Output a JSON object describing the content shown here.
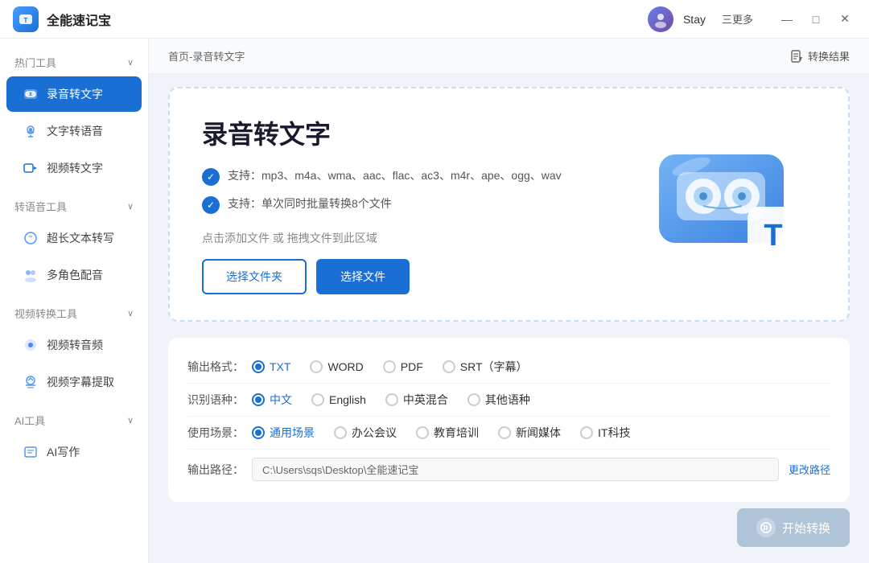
{
  "app": {
    "logo_text": "T",
    "name": "全能速记宝",
    "user": "Stay",
    "more_label": "三更多"
  },
  "titlebar": {
    "minimize": "—",
    "maximize": "□",
    "close": "✕"
  },
  "breadcrumb": {
    "path": "首页-录音转文字",
    "result_btn": "转换结果"
  },
  "sidebar": {
    "sections": [
      {
        "label": "热门工具",
        "items": [
          {
            "id": "audio-to-text",
            "label": "录音转文字",
            "active": true
          },
          {
            "id": "text-to-speech",
            "label": "文字转语音",
            "active": false
          },
          {
            "id": "video-to-text",
            "label": "视频转文字",
            "active": false
          }
        ]
      },
      {
        "label": "转语音工具",
        "items": [
          {
            "id": "long-text",
            "label": "超长文本转写",
            "active": false
          },
          {
            "id": "multi-role",
            "label": "多角色配音",
            "active": false
          }
        ]
      },
      {
        "label": "视频转换工具",
        "items": [
          {
            "id": "video-audio",
            "label": "视频转音频",
            "active": false
          },
          {
            "id": "video-subtitle",
            "label": "视频字幕提取",
            "active": false
          }
        ]
      },
      {
        "label": "AI工具",
        "items": [
          {
            "id": "ai-write",
            "label": "AI写作",
            "active": false
          }
        ]
      }
    ]
  },
  "main": {
    "title": "录音转文字",
    "feature1": "支持：mp3、m4a、wma、aac、flac、ac3、m4r、ape、ogg、wav",
    "feature2": "支持：单次同时批量转换8个文件",
    "upload_hint": "点击添加文件 或 拖拽文件到此区域",
    "btn_folder": "选择文件夹",
    "btn_file": "选择文件"
  },
  "settings": {
    "format_label": "输出格式：",
    "formats": [
      {
        "label": "TXT",
        "selected": true
      },
      {
        "label": "WORD",
        "selected": false
      },
      {
        "label": "PDF",
        "selected": false
      },
      {
        "label": "SRT（字幕）",
        "selected": false
      }
    ],
    "lang_label": "识别语种：",
    "langs": [
      {
        "label": "中文",
        "selected": true
      },
      {
        "label": "English",
        "selected": false
      },
      {
        "label": "中英混合",
        "selected": false
      },
      {
        "label": "其他语种",
        "selected": false
      }
    ],
    "scene_label": "使用场景：",
    "scenes": [
      {
        "label": "通用场景",
        "selected": true
      },
      {
        "label": "办公会议",
        "selected": false
      },
      {
        "label": "教育培训",
        "selected": false
      },
      {
        "label": "新闻媒体",
        "selected": false
      },
      {
        "label": "IT科技",
        "selected": false
      }
    ],
    "path_label": "输出路径：",
    "path_value": "C:\\Users\\sqs\\Desktop\\全能速记宝",
    "path_change": "更改路径"
  },
  "start_btn": "开始转换"
}
